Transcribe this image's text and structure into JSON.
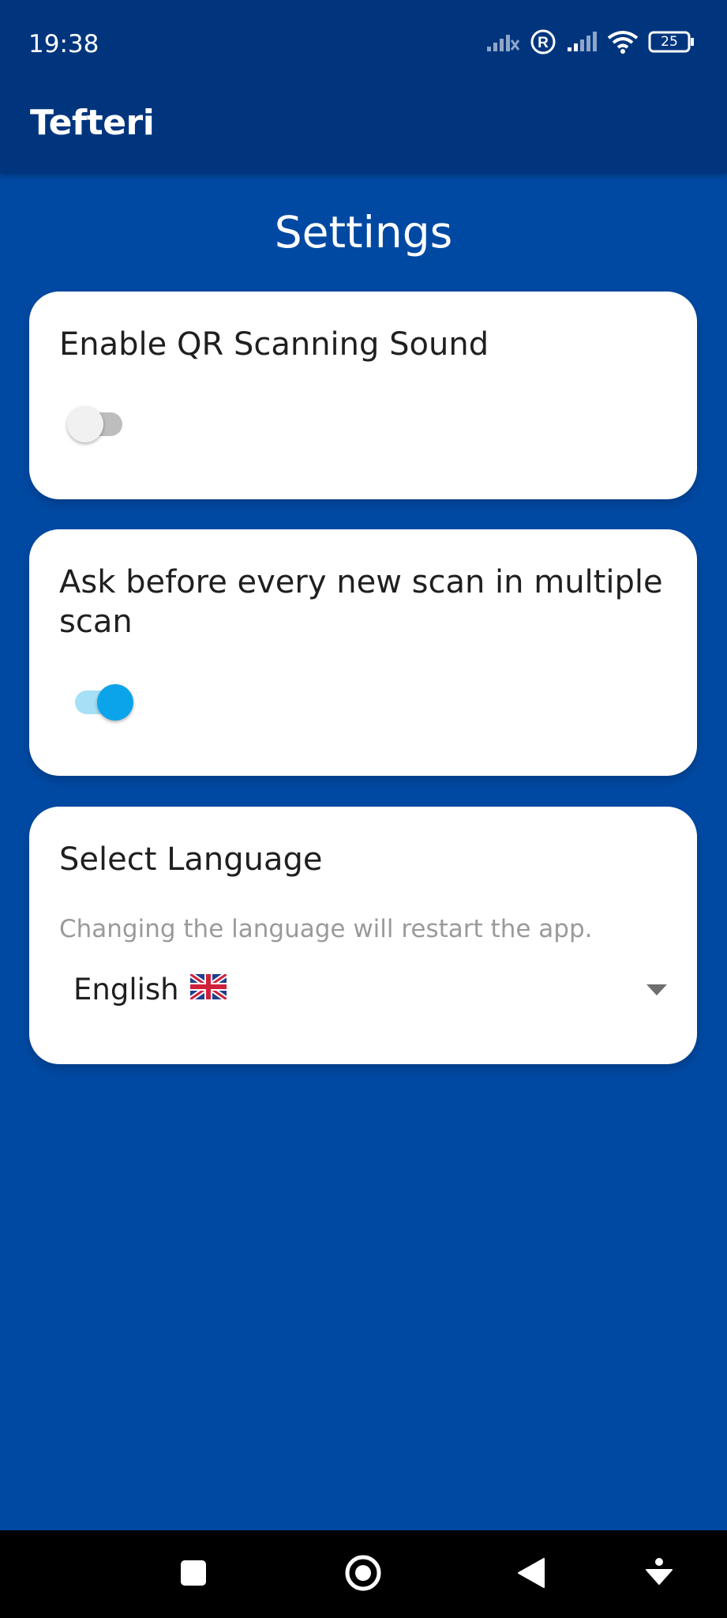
{
  "status_bar": {
    "time": "19:38",
    "battery_level": "25",
    "icons": [
      "signal-off-icon",
      "roaming-icon",
      "signal-icon",
      "wifi-icon",
      "battery-icon"
    ]
  },
  "app_bar": {
    "title": "Tefteri"
  },
  "page": {
    "title": "Settings"
  },
  "settings": {
    "scan_sound": {
      "label": "Enable QR Scanning Sound",
      "enabled": false
    },
    "ask_before_scan": {
      "label": "Ask before every new scan in multiple scan",
      "enabled": true
    },
    "language": {
      "label": "Select Language",
      "hint": "Changing the language will restart the app.",
      "selected": "English",
      "flag_icon": "uk-flag-icon"
    }
  },
  "nav_bar": {
    "icons": [
      "recents-square-icon",
      "home-circle-icon",
      "back-triangle-icon",
      "assist-down-icon"
    ]
  },
  "colors": {
    "background": "#0049a3",
    "app_bar": "#00357e",
    "toggle_on": "#0ba4ea",
    "toggle_off": "#bdbdbd"
  }
}
